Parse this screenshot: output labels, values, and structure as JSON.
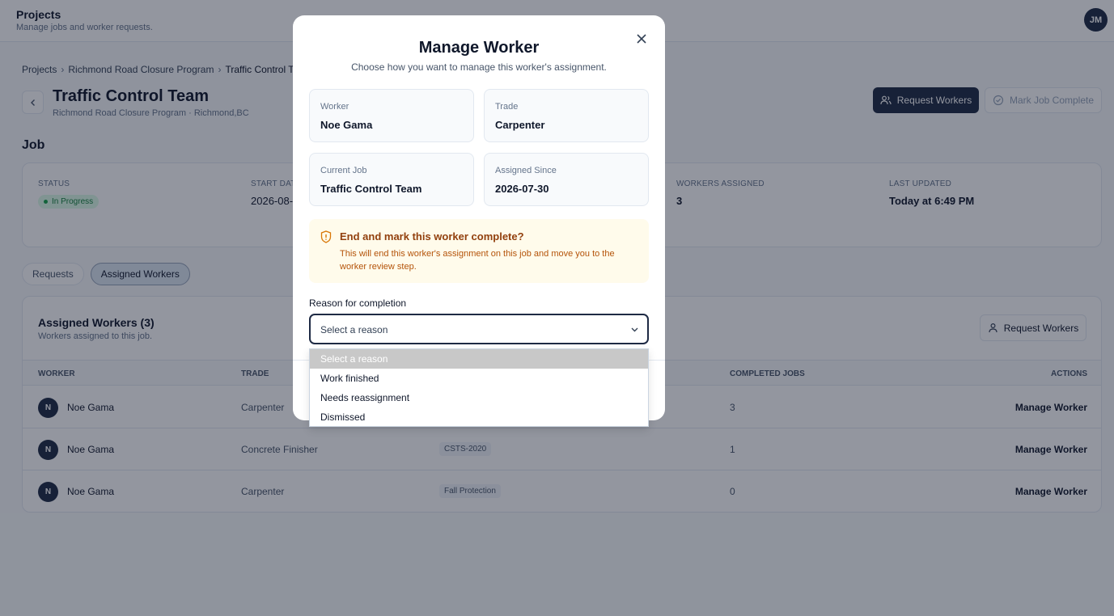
{
  "header": {
    "title": "Projects",
    "subtitle": "Manage jobs and worker requests.",
    "avatar": "JM"
  },
  "breadcrumb": {
    "items": [
      "Projects",
      "Richmond Road Closure Program",
      "Traffic Control Team"
    ]
  },
  "page": {
    "title": "Traffic Control Team",
    "subtitle": "Richmond Road Closure Program · Richmond,BC",
    "request_workers_label": "Request Workers",
    "mark_complete_label": "Mark Job Complete"
  },
  "job": {
    "section_title": "Job",
    "status_label": "STATUS",
    "status_value": "In Progress",
    "start_label": "START DATE",
    "start_value": "2026-08-",
    "workers_label": "WORKERS ASSIGNED",
    "workers_value": "3",
    "updated_label": "LAST UPDATED",
    "updated_value": "Today at 6:49 PM"
  },
  "tabs": [
    "Requests",
    "Assigned Workers"
  ],
  "workers": {
    "title": "Assigned Workers (3)",
    "subtitle": "Workers assigned to this job.",
    "request_button": "Request Workers",
    "columns": {
      "worker": "WORKER",
      "trade": "TRADE",
      "completed": "COMPLETED JOBS",
      "actions": "ACTIONS"
    },
    "rows": [
      {
        "initial": "N",
        "name": "Noe Gama",
        "trade": "Carpenter",
        "cert": "",
        "completed": "3",
        "action": "Manage Worker"
      },
      {
        "initial": "N",
        "name": "Noe Gama",
        "trade": "Concrete Finisher",
        "cert": "CSTS-2020",
        "completed": "1",
        "action": "Manage Worker"
      },
      {
        "initial": "N",
        "name": "Noe Gama",
        "trade": "Carpenter",
        "cert": "Fall Protection",
        "completed": "0",
        "action": "Manage Worker"
      }
    ]
  },
  "modal": {
    "title": "Manage Worker",
    "subtitle": "Choose how you want to manage this worker's assignment.",
    "worker_label": "Worker",
    "worker_value": "Noe Gama",
    "trade_label": "Trade",
    "trade_value": "Carpenter",
    "job_label": "Current Job",
    "job_value": "Traffic Control Team",
    "since_label": "Assigned Since",
    "since_value": "2026-07-30",
    "warning_title": "End and mark this worker complete?",
    "warning_text": "This will end this worker's assignment on this job and move you to the worker review step.",
    "reason_label": "Reason for completion",
    "select_value": "Select a reason",
    "options": [
      "Select a reason",
      "Work finished",
      "Needs reassignment",
      "Dismissed"
    ]
  }
}
